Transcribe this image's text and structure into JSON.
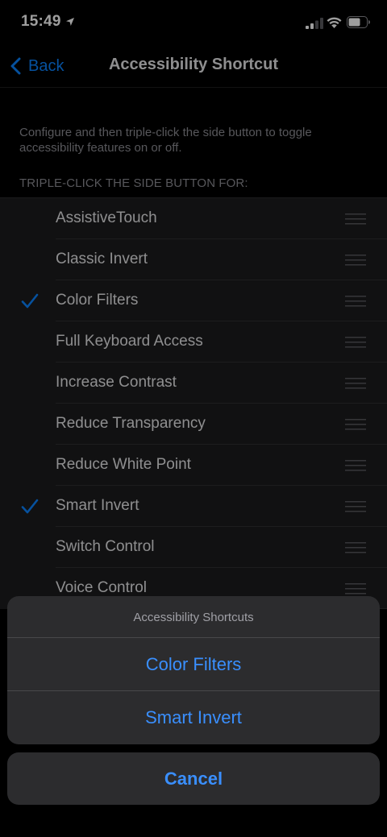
{
  "status_bar": {
    "time": "15:49",
    "icons": [
      "location-arrow-icon",
      "cellular-signal-icon",
      "wifi-icon",
      "battery-icon"
    ]
  },
  "nav": {
    "back_label": "Back",
    "title": "Accessibility Shortcut"
  },
  "description": "Configure and then triple-click the side button to toggle accessibility features on or off.",
  "section_header": "TRIPLE-CLICK THE SIDE BUTTON FOR:",
  "items": [
    {
      "label": "AssistiveTouch",
      "checked": false
    },
    {
      "label": "Classic Invert",
      "checked": false
    },
    {
      "label": "Color Filters",
      "checked": true
    },
    {
      "label": "Full Keyboard Access",
      "checked": false
    },
    {
      "label": "Increase Contrast",
      "checked": false
    },
    {
      "label": "Reduce Transparency",
      "checked": false
    },
    {
      "label": "Reduce White Point",
      "checked": false
    },
    {
      "label": "Smart Invert",
      "checked": true
    },
    {
      "label": "Switch Control",
      "checked": false
    },
    {
      "label": "Voice Control",
      "checked": false
    }
  ],
  "action_sheet": {
    "title": "Accessibility Shortcuts",
    "actions": [
      "Color Filters",
      "Smart Invert"
    ],
    "cancel_label": "Cancel"
  },
  "colors": {
    "accent": "#0a84ff",
    "background": "#000000",
    "cell_background": "#1c1c1e",
    "sheet_background": "#2c2c2e"
  }
}
